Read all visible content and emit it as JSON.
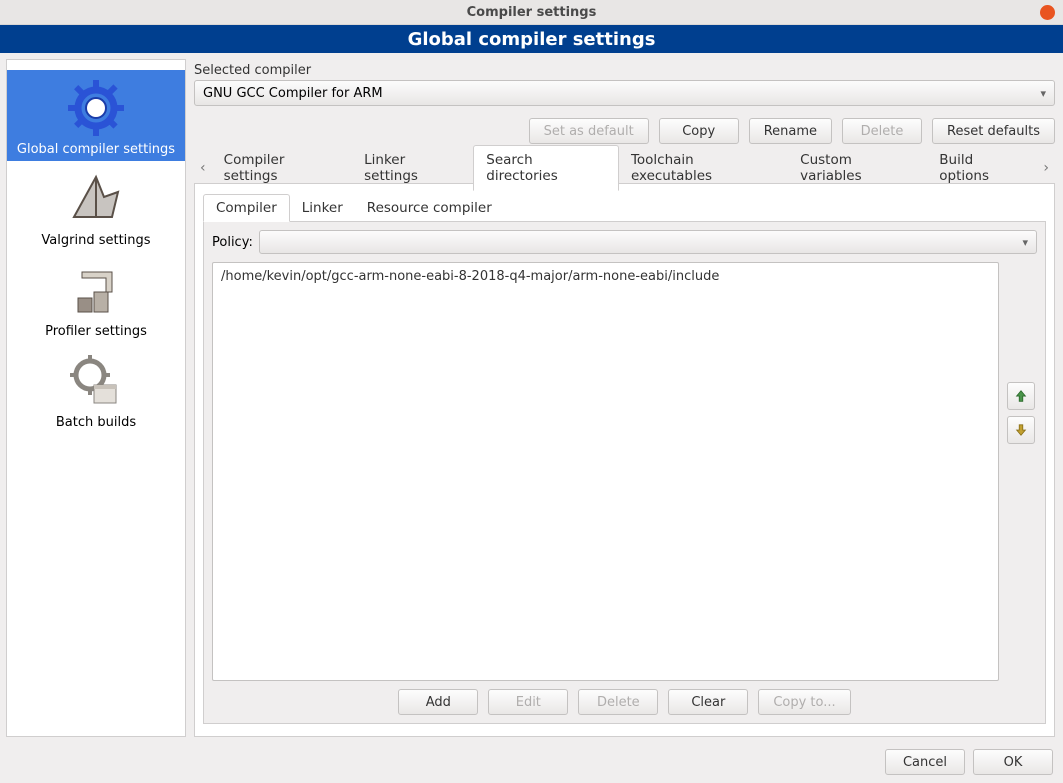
{
  "titlebar": {
    "title": "Compiler settings"
  },
  "banner": "Global compiler settings",
  "sidebar": {
    "items": [
      {
        "label": "Global compiler settings",
        "selected": true
      },
      {
        "label": "Valgrind settings"
      },
      {
        "label": "Profiler settings"
      },
      {
        "label": "Batch builds"
      }
    ]
  },
  "selected_compiler": {
    "label": "Selected compiler",
    "value": "GNU GCC Compiler for ARM"
  },
  "top_buttons": {
    "set_default": "Set as default",
    "copy": "Copy",
    "rename": "Rename",
    "delete": "Delete",
    "reset": "Reset defaults"
  },
  "tabs": [
    {
      "label": "Compiler settings"
    },
    {
      "label": "Linker settings"
    },
    {
      "label": "Search directories",
      "active": true
    },
    {
      "label": "Toolchain executables"
    },
    {
      "label": "Custom variables"
    },
    {
      "label": "Build options"
    }
  ],
  "subtabs": [
    {
      "label": "Compiler",
      "active": true
    },
    {
      "label": "Linker"
    },
    {
      "label": "Resource compiler"
    }
  ],
  "policy": {
    "label": "Policy:",
    "value": ""
  },
  "directories": [
    "/home/kevin/opt/gcc-arm-none-eabi-8-2018-q4-major/arm-none-eabi/include"
  ],
  "dir_buttons": {
    "add": "Add",
    "edit": "Edit",
    "delete": "Delete",
    "clear": "Clear",
    "copyto": "Copy to..."
  },
  "footer": {
    "cancel": "Cancel",
    "ok": "OK"
  }
}
